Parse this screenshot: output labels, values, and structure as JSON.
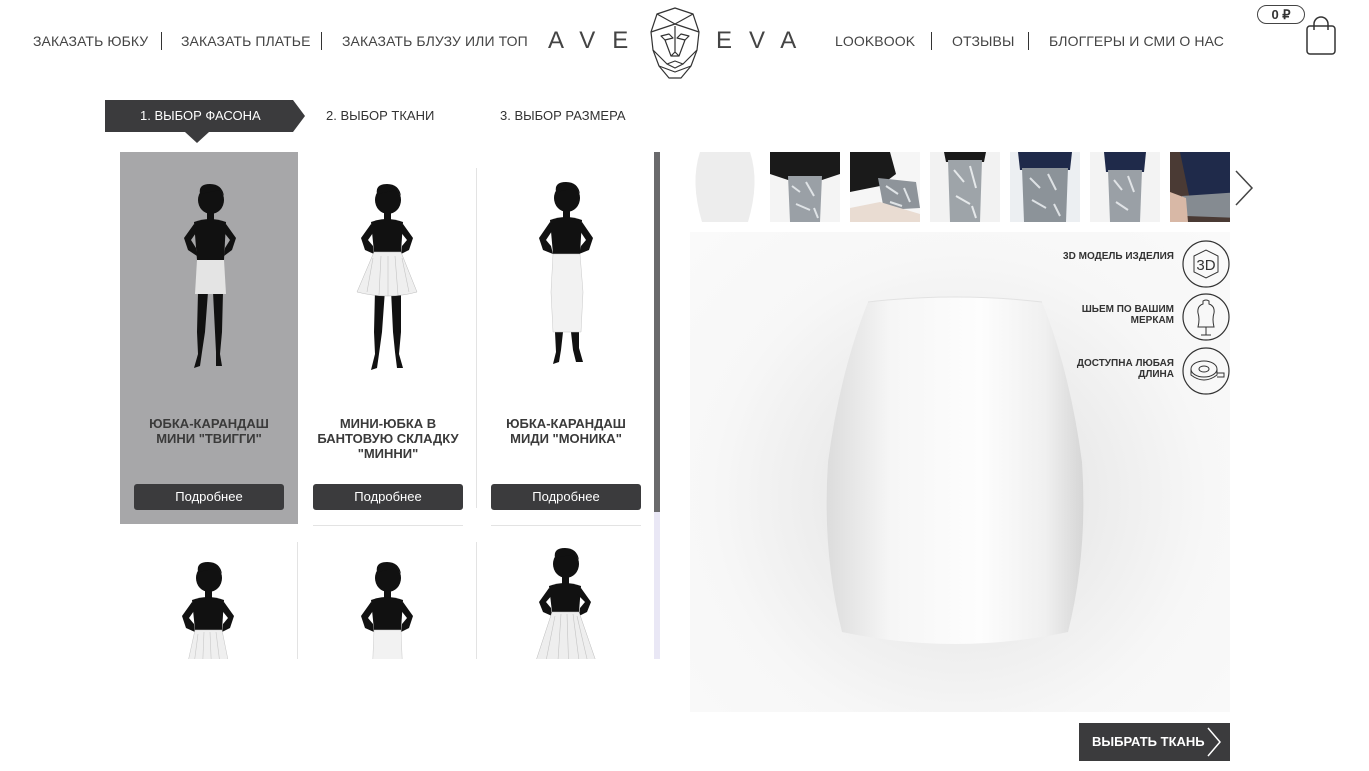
{
  "header": {
    "nav_left": [
      "ЗАКАЗАТЬ ЮБКУ",
      "ЗАКАЗАТЬ ПЛАТЬЕ",
      "ЗАКАЗАТЬ БЛУЗУ ИЛИ ТОП"
    ],
    "logo_left": "AVE",
    "logo_right": "EVA",
    "nav_right": [
      "LOOKBOOK",
      "ОТЗЫВЫ",
      "БЛОГГЕРЫ И СМИ О НАС"
    ],
    "cart_total": "0 ₽"
  },
  "steps": [
    {
      "label": "1. ВЫБОР ФАСОНА",
      "active": true
    },
    {
      "label": "2. ВЫБОР ТКАНИ",
      "active": false
    },
    {
      "label": "3. ВЫБОР РАЗМЕРА",
      "active": false
    }
  ],
  "products": [
    {
      "title": "ЮБКА-КАРАНДАШ МИНИ \"ТВИГГИ\"",
      "button": "Подробнее",
      "selected": true
    },
    {
      "title": "МИНИ-ЮБКА В БАНТОВУЮ СКЛАДКУ \"МИННИ\"",
      "button": "Подробнее",
      "selected": false
    },
    {
      "title": "ЮБКА-КАРАНДАШ МИДИ \"МОНИКА\"",
      "button": "Подробнее",
      "selected": false
    }
  ],
  "features": [
    {
      "text": "3D МОДЕЛЬ ИЗДЕЛИЯ",
      "icon": "3d-model-icon",
      "icon_text": "3D"
    },
    {
      "text": "ШЬЕМ ПО ВАШИМ МЕРКАМ",
      "icon": "dress-form-icon"
    },
    {
      "text": "ДОСТУПНА ЛЮБАЯ ДЛИНА",
      "icon": "measuring-tape-icon"
    }
  ],
  "choose_fabric_button": "ВЫБРАТЬ ТКАНЬ",
  "colors": {
    "dark": "#3b3b3d",
    "selected_card": "#a7a7a9",
    "scrollbar_track": "#e9e7f5",
    "navy": "#1f2a4a"
  }
}
